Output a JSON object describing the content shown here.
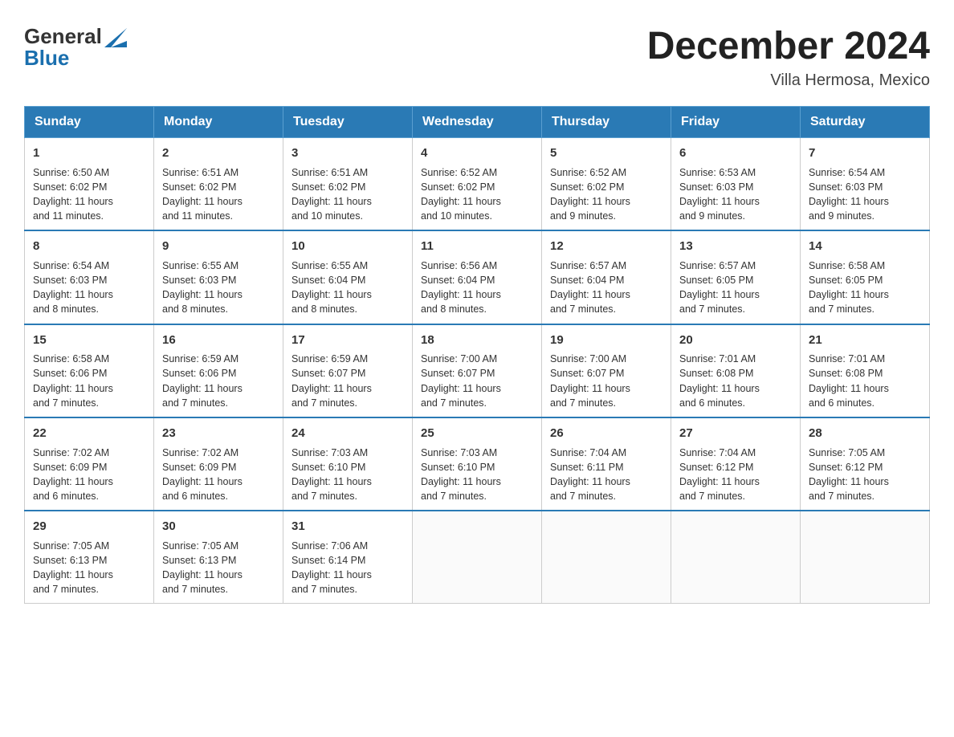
{
  "header": {
    "title": "December 2024",
    "location": "Villa Hermosa, Mexico",
    "logo_line1": "General",
    "logo_line2": "Blue"
  },
  "days_of_week": [
    "Sunday",
    "Monday",
    "Tuesday",
    "Wednesday",
    "Thursday",
    "Friday",
    "Saturday"
  ],
  "weeks": [
    [
      {
        "day": "1",
        "info": "Sunrise: 6:50 AM\nSunset: 6:02 PM\nDaylight: 11 hours\nand 11 minutes."
      },
      {
        "day": "2",
        "info": "Sunrise: 6:51 AM\nSunset: 6:02 PM\nDaylight: 11 hours\nand 11 minutes."
      },
      {
        "day": "3",
        "info": "Sunrise: 6:51 AM\nSunset: 6:02 PM\nDaylight: 11 hours\nand 10 minutes."
      },
      {
        "day": "4",
        "info": "Sunrise: 6:52 AM\nSunset: 6:02 PM\nDaylight: 11 hours\nand 10 minutes."
      },
      {
        "day": "5",
        "info": "Sunrise: 6:52 AM\nSunset: 6:02 PM\nDaylight: 11 hours\nand 9 minutes."
      },
      {
        "day": "6",
        "info": "Sunrise: 6:53 AM\nSunset: 6:03 PM\nDaylight: 11 hours\nand 9 minutes."
      },
      {
        "day": "7",
        "info": "Sunrise: 6:54 AM\nSunset: 6:03 PM\nDaylight: 11 hours\nand 9 minutes."
      }
    ],
    [
      {
        "day": "8",
        "info": "Sunrise: 6:54 AM\nSunset: 6:03 PM\nDaylight: 11 hours\nand 8 minutes."
      },
      {
        "day": "9",
        "info": "Sunrise: 6:55 AM\nSunset: 6:03 PM\nDaylight: 11 hours\nand 8 minutes."
      },
      {
        "day": "10",
        "info": "Sunrise: 6:55 AM\nSunset: 6:04 PM\nDaylight: 11 hours\nand 8 minutes."
      },
      {
        "day": "11",
        "info": "Sunrise: 6:56 AM\nSunset: 6:04 PM\nDaylight: 11 hours\nand 8 minutes."
      },
      {
        "day": "12",
        "info": "Sunrise: 6:57 AM\nSunset: 6:04 PM\nDaylight: 11 hours\nand 7 minutes."
      },
      {
        "day": "13",
        "info": "Sunrise: 6:57 AM\nSunset: 6:05 PM\nDaylight: 11 hours\nand 7 minutes."
      },
      {
        "day": "14",
        "info": "Sunrise: 6:58 AM\nSunset: 6:05 PM\nDaylight: 11 hours\nand 7 minutes."
      }
    ],
    [
      {
        "day": "15",
        "info": "Sunrise: 6:58 AM\nSunset: 6:06 PM\nDaylight: 11 hours\nand 7 minutes."
      },
      {
        "day": "16",
        "info": "Sunrise: 6:59 AM\nSunset: 6:06 PM\nDaylight: 11 hours\nand 7 minutes."
      },
      {
        "day": "17",
        "info": "Sunrise: 6:59 AM\nSunset: 6:07 PM\nDaylight: 11 hours\nand 7 minutes."
      },
      {
        "day": "18",
        "info": "Sunrise: 7:00 AM\nSunset: 6:07 PM\nDaylight: 11 hours\nand 7 minutes."
      },
      {
        "day": "19",
        "info": "Sunrise: 7:00 AM\nSunset: 6:07 PM\nDaylight: 11 hours\nand 7 minutes."
      },
      {
        "day": "20",
        "info": "Sunrise: 7:01 AM\nSunset: 6:08 PM\nDaylight: 11 hours\nand 6 minutes."
      },
      {
        "day": "21",
        "info": "Sunrise: 7:01 AM\nSunset: 6:08 PM\nDaylight: 11 hours\nand 6 minutes."
      }
    ],
    [
      {
        "day": "22",
        "info": "Sunrise: 7:02 AM\nSunset: 6:09 PM\nDaylight: 11 hours\nand 6 minutes."
      },
      {
        "day": "23",
        "info": "Sunrise: 7:02 AM\nSunset: 6:09 PM\nDaylight: 11 hours\nand 6 minutes."
      },
      {
        "day": "24",
        "info": "Sunrise: 7:03 AM\nSunset: 6:10 PM\nDaylight: 11 hours\nand 7 minutes."
      },
      {
        "day": "25",
        "info": "Sunrise: 7:03 AM\nSunset: 6:10 PM\nDaylight: 11 hours\nand 7 minutes."
      },
      {
        "day": "26",
        "info": "Sunrise: 7:04 AM\nSunset: 6:11 PM\nDaylight: 11 hours\nand 7 minutes."
      },
      {
        "day": "27",
        "info": "Sunrise: 7:04 AM\nSunset: 6:12 PM\nDaylight: 11 hours\nand 7 minutes."
      },
      {
        "day": "28",
        "info": "Sunrise: 7:05 AM\nSunset: 6:12 PM\nDaylight: 11 hours\nand 7 minutes."
      }
    ],
    [
      {
        "day": "29",
        "info": "Sunrise: 7:05 AM\nSunset: 6:13 PM\nDaylight: 11 hours\nand 7 minutes."
      },
      {
        "day": "30",
        "info": "Sunrise: 7:05 AM\nSunset: 6:13 PM\nDaylight: 11 hours\nand 7 minutes."
      },
      {
        "day": "31",
        "info": "Sunrise: 7:06 AM\nSunset: 6:14 PM\nDaylight: 11 hours\nand 7 minutes."
      },
      null,
      null,
      null,
      null
    ]
  ]
}
